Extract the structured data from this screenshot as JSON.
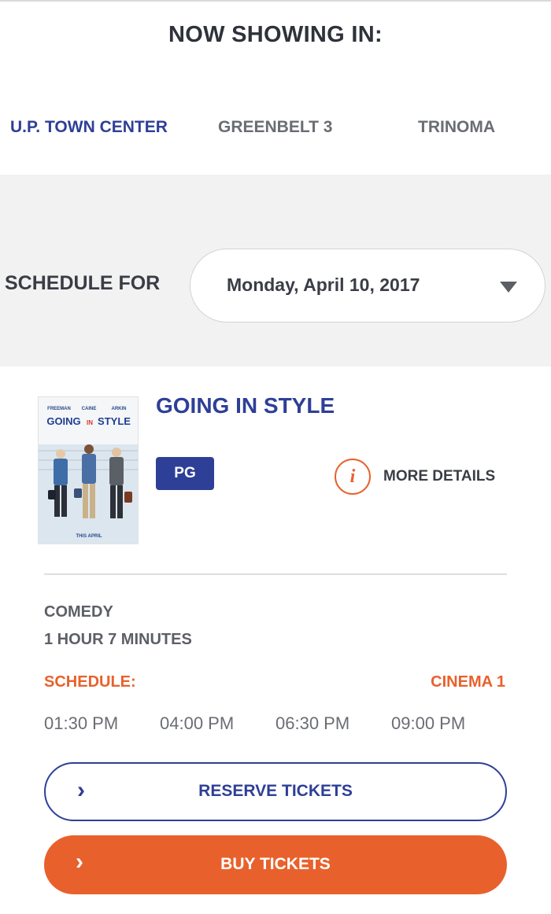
{
  "header": {
    "title": "NOW SHOWING IN:"
  },
  "locations": [
    {
      "label": "U.P. TOWN CENTER",
      "active": true
    },
    {
      "label": "GREENBELT 3",
      "active": false
    },
    {
      "label": "TRINOMA",
      "active": false
    }
  ],
  "schedule_for": {
    "label": "SCHEDULE FOR",
    "selected_date": "Monday, April 10, 2017"
  },
  "movie": {
    "title": "GOING IN STYLE",
    "rating": "PG",
    "more_details_label": "MORE DETAILS",
    "genre": "COMEDY",
    "duration": "1 HOUR 7 MINUTES",
    "schedule_label": "SCHEDULE:",
    "cinema": "CINEMA 1",
    "showtimes": [
      "01:30 PM",
      "04:00 PM",
      "06:30 PM",
      "09:00 PM"
    ],
    "poster": {
      "cast": [
        "FREEMAN",
        "CAINE",
        "ARKIN"
      ],
      "title_part1": "GOING",
      "title_part2": "IN",
      "title_part3": "STYLE",
      "footer": "THIS APRIL"
    }
  },
  "actions": {
    "reserve_label": "RESERVE TICKETS",
    "buy_label": "BUY TICKETS"
  },
  "colors": {
    "brand_blue": "#2e3f97",
    "accent_orange": "#e8612c",
    "band_gray": "#f2f2f2"
  },
  "icons": {
    "dropdown": "caret-down-icon",
    "info": "info-icon",
    "chevron": "chevron-right-icon"
  }
}
